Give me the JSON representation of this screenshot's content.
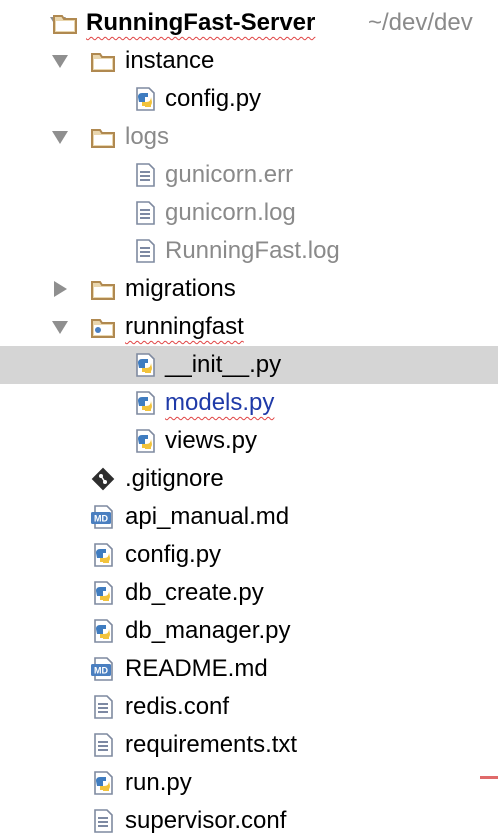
{
  "project": {
    "name": "RunningFast-Server",
    "path": "~/dev/dev"
  },
  "tree": {
    "instance": {
      "label": "instance",
      "files": {
        "config": "config.py"
      }
    },
    "logs": {
      "label": "logs",
      "files": {
        "gunicorn_err": "gunicorn.err",
        "gunicorn_log": "gunicorn.log",
        "runningfast_log": "RunningFast.log"
      }
    },
    "migrations": {
      "label": "migrations"
    },
    "runningfast": {
      "label": "runningfast",
      "files": {
        "init": "__init__.py",
        "models": "models.py",
        "views": "views.py"
      }
    },
    "root_files": {
      "gitignore": ".gitignore",
      "api_manual": "api_manual.md",
      "config": "config.py",
      "db_create": "db_create.py",
      "db_manager": "db_manager.py",
      "readme": "README.md",
      "redis_conf": "redis.conf",
      "requirements": "requirements.txt",
      "run": "run.py",
      "supervisor_conf": "supervisor.conf"
    }
  },
  "icons": {
    "folder": "folder-icon",
    "package": "package-folder-icon",
    "python": "python-file-icon",
    "text": "text-file-icon",
    "markdown": "markdown-file-icon",
    "git": "git-file-icon"
  },
  "colors": {
    "selection": "#d5d5d5",
    "folder": "#c8a46a",
    "muted_text": "#8a8a8a",
    "modified_blue": "#1f3aa8",
    "python_blue": "#3f7cc0",
    "python_yellow": "#f2c33c"
  }
}
